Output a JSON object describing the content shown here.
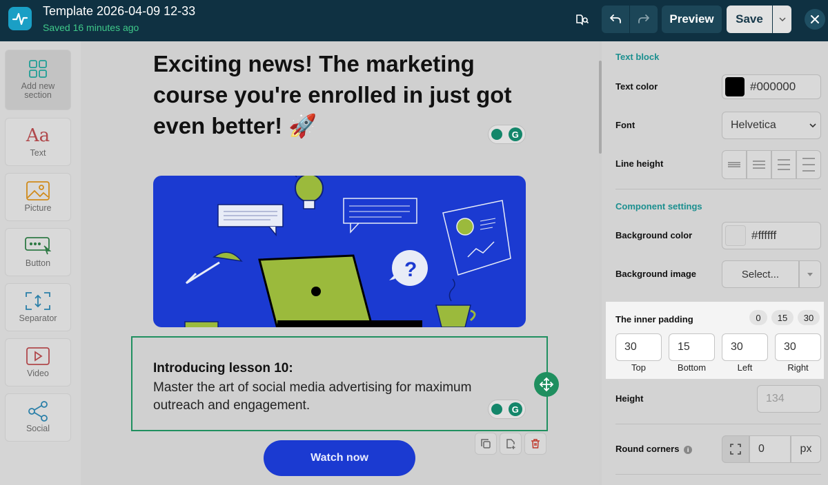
{
  "header": {
    "title": "Template 2026-04-09 12-33",
    "saved_status": "Saved 16 minutes ago",
    "preview_label": "Preview",
    "save_label": "Save"
  },
  "sidebar": {
    "items": [
      {
        "label": "Add new section",
        "icon": "grid-icon"
      },
      {
        "label": "Text",
        "icon": "text-aa-icon"
      },
      {
        "label": "Picture",
        "icon": "picture-icon"
      },
      {
        "label": "Button",
        "icon": "button-icon"
      },
      {
        "label": "Separator",
        "icon": "separator-icon"
      },
      {
        "label": "Video",
        "icon": "video-icon"
      },
      {
        "label": "Social",
        "icon": "share-icon"
      }
    ]
  },
  "canvas": {
    "headline": "Exciting news! The marketing course you're enrolled in just got even better! 🚀",
    "text_block_title": "Introducing lesson 10:",
    "text_block_body": "Master the art of social media advertising for maximum outreach and engagement.",
    "cta_label": "Watch now"
  },
  "panel": {
    "text_block_heading": "Text block",
    "text_color_label": "Text color",
    "text_color_value": "#000000",
    "font_label": "Font",
    "font_value": "Helvetica",
    "line_height_label": "Line height",
    "component_settings_heading": "Component settings",
    "bg_color_label": "Background color",
    "bg_color_value": "#ffffff",
    "bg_image_label": "Background image",
    "bg_image_value": "Select...",
    "inner_padding_label": "The inner padding",
    "presets": [
      "0",
      "15",
      "30"
    ],
    "padding": [
      {
        "caption": "Top",
        "value": "30"
      },
      {
        "caption": "Bottom",
        "value": "15"
      },
      {
        "caption": "Left",
        "value": "30"
      },
      {
        "caption": "Right",
        "value": "30"
      }
    ],
    "height_label": "Height",
    "height_placeholder": "134",
    "round_corners_label": "Round corners",
    "round_corners_value": "0",
    "round_corners_unit": "px"
  },
  "colors": {
    "topbar": "#0f3142",
    "accent_green": "#3fc98a",
    "hero_blue": "#1b3ad1",
    "section_heading": "#1b8f8f"
  }
}
